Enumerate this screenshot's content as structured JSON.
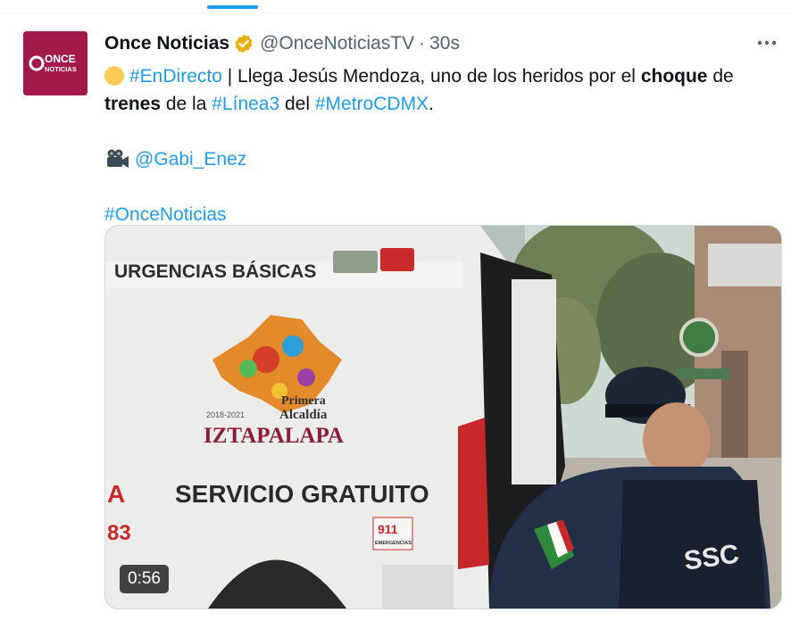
{
  "tweet": {
    "author_name": "Once Noticias",
    "handle": "@OnceNoticiasTV",
    "separator": "·",
    "time": "30s",
    "avatar_text_top": "ONCE",
    "avatar_text_bottom": "NOTICIAS",
    "text": {
      "hashtag_endirecto": "#EnDirecto",
      "part1": " | Llega Jesús Mendoza, uno de los heridos por el ",
      "bold1": "choque",
      "part2": " de",
      "bold2": "trenes",
      "part3": " de la ",
      "hashtag_linea3": "#Línea3",
      "part4": " del ",
      "hashtag_metro": "#MetroCDMX",
      "part5": ".",
      "mention": "@Gabi_Enez",
      "hashtag_once": "#OnceNoticias"
    },
    "video": {
      "duration": "0:56",
      "sign_urgencias": "URGENCIAS BÁSICAS",
      "sign_primera": "Primera",
      "sign_years": "2018-2021",
      "sign_alcaldia": "Alcaldía",
      "sign_iztapalapa": "IZTAPALAPA",
      "sign_servicio": "SERVICIO GRATUITO",
      "sign_911": "911",
      "sign_emergencias": "EMERGENCIAS",
      "sign_a": "A",
      "sign_83": "83",
      "sign_ssc": "SSC"
    }
  },
  "colors": {
    "link": "#1d9bf0",
    "text": "#0f1419",
    "secondary": "#536471",
    "verified": "#e8b10d",
    "avatar": "#b0204d"
  },
  "icons": [
    "verified-badge-icon",
    "more-options-icon",
    "circle-emoji-icon",
    "video-camera-icon"
  ]
}
